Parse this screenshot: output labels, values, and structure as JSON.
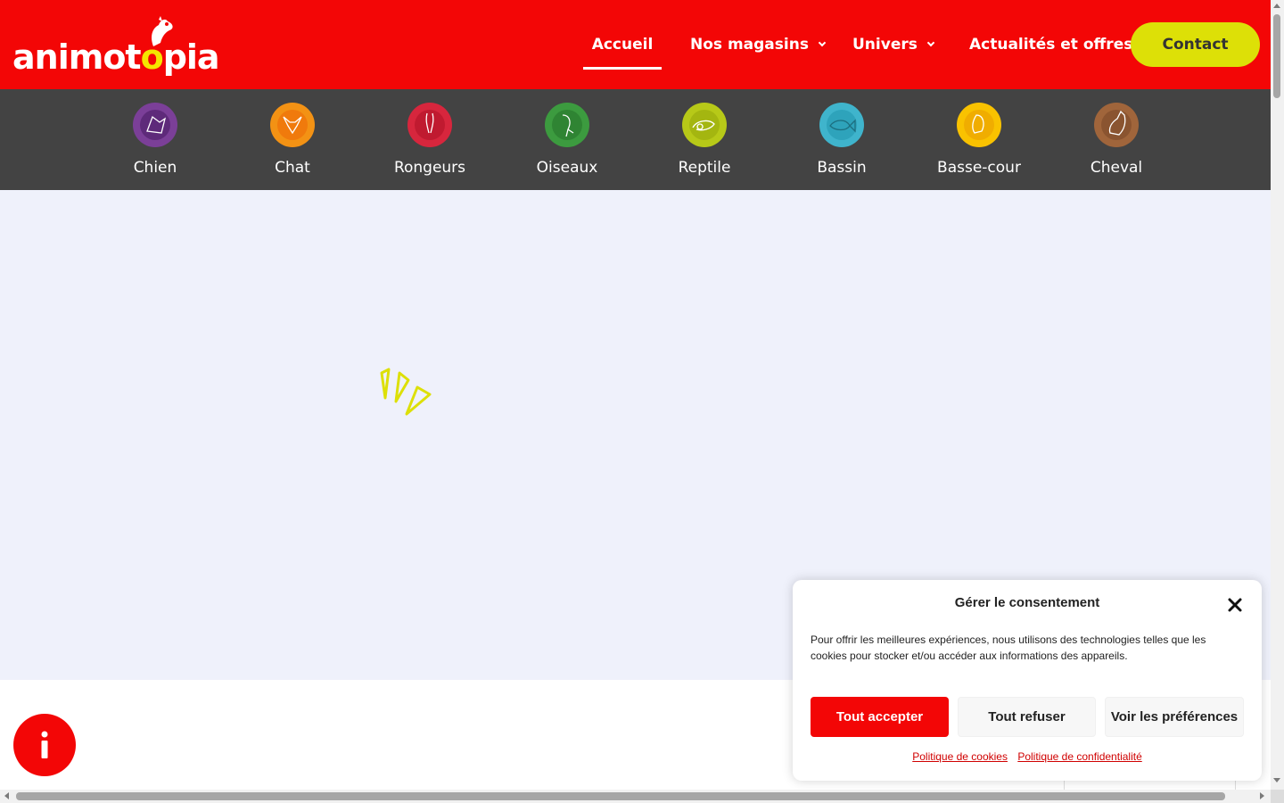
{
  "header": {
    "logo": {
      "text_main": "animot",
      "text_o": "o",
      "text_end": "pia",
      "icon": "dog-logo-icon"
    },
    "nav": [
      {
        "label": "Accueil",
        "active": true
      },
      {
        "label": "Nos magasins",
        "has_dropdown": true
      },
      {
        "label": "Univers",
        "has_dropdown": true
      },
      {
        "label": "Actualités et offres"
      }
    ],
    "contact_label": "Contact"
  },
  "categories": [
    {
      "label": "Chien",
      "icon": "dog-icon",
      "color": "#7b3f98"
    },
    {
      "label": "Chat",
      "icon": "cat-icon",
      "color": "#f39214"
    },
    {
      "label": "Rongeurs",
      "icon": "rabbit-icon",
      "color": "#d7263d"
    },
    {
      "label": "Oiseaux",
      "icon": "bird-icon",
      "color": "#3c9b3f"
    },
    {
      "label": "Reptile",
      "icon": "chameleon-icon",
      "color": "#b7c918"
    },
    {
      "label": "Bassin",
      "icon": "fish-icon",
      "color": "#3fb4cc"
    },
    {
      "label": "Basse-cour",
      "icon": "hen-icon",
      "color": "#f9c200"
    },
    {
      "label": "Cheval",
      "icon": "horse-icon",
      "color": "#a0653b"
    }
  ],
  "consent": {
    "title": "Gérer le consentement",
    "text": "Pour offrir les meilleures expériences, nous utilisons des technologies telles que les cookies pour stocker et/ou accéder aux informations des appareils.",
    "accept_label": "Tout accepter",
    "refuse_label": "Tout refuser",
    "prefs_label": "Voir les préférences",
    "cookie_policy_label": "Politique de cookies",
    "privacy_policy_label": "Politique de confidentialité"
  },
  "colors": {
    "brand_red": "#f30606",
    "accent_yellow": "#dde007",
    "category_bar": "#434343",
    "page_bg": "#eff1fb"
  },
  "info_button_icon": "info-icon",
  "loader_icon": "loading-spinner-icon"
}
